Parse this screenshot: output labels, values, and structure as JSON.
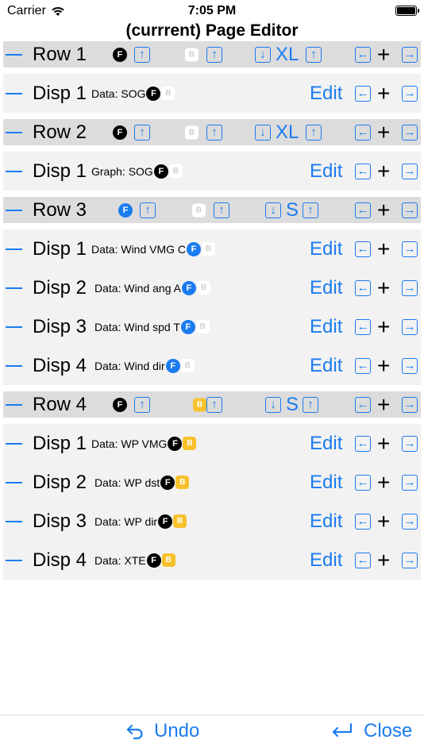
{
  "status": {
    "carrier": "Carrier",
    "time": "7:05 PM"
  },
  "title": "(currrent) Page Editor",
  "icons": {
    "f": "F",
    "b": "B",
    "up": "↑",
    "down": "↓",
    "left": "←",
    "right": "→",
    "plus": "+"
  },
  "colors": {
    "accent": "#1b7cf0",
    "black_badge": "#000000",
    "blue_badge": "#1b7cf0",
    "yellow_badge": "#f8c12c",
    "header_bg": "#dcdcdc",
    "row_bg": "#f2f2f2"
  },
  "rows": [
    {
      "label": "Row 1",
      "font_badge": "black",
      "bg_badge": "white",
      "size": "XL",
      "displays": [
        {
          "label": "Disp 1",
          "info": "Data: SOG",
          "font_badge": "black",
          "bg_badge": "white"
        }
      ]
    },
    {
      "label": "Row 2",
      "font_badge": "black",
      "bg_badge": "white",
      "size": "XL",
      "displays": [
        {
          "label": "Disp 1",
          "info": "Graph: SOG",
          "font_badge": "black",
          "bg_badge": "white"
        }
      ]
    },
    {
      "label": "Row 3",
      "font_badge": "blue",
      "bg_badge": "white",
      "size": "S",
      "displays": [
        {
          "label": "Disp 1",
          "info": "Data: Wind VMG C",
          "font_badge": "blue",
          "bg_badge": "white"
        },
        {
          "label": "Disp 2",
          "info": "Data: Wind ang A",
          "font_badge": "blue",
          "bg_badge": "white"
        },
        {
          "label": "Disp 3",
          "info": "Data: Wind spd T",
          "font_badge": "blue",
          "bg_badge": "white"
        },
        {
          "label": "Disp 4",
          "info": "Data: Wind dir",
          "font_badge": "blue",
          "bg_badge": "white"
        }
      ]
    },
    {
      "label": "Row 4",
      "font_badge": "black",
      "bg_badge": "yellow",
      "size": "S",
      "displays": [
        {
          "label": "Disp 1",
          "info": "Data: WP VMG",
          "font_badge": "black",
          "bg_badge": "yellow"
        },
        {
          "label": "Disp 2",
          "info": "Data: WP dst",
          "font_badge": "black",
          "bg_badge": "yellow"
        },
        {
          "label": "Disp 3",
          "info": "Data: WP dir",
          "font_badge": "black",
          "bg_badge": "yellow"
        },
        {
          "label": "Disp 4",
          "info": "Data: XTE",
          "font_badge": "black",
          "bg_badge": "yellow"
        }
      ]
    }
  ],
  "edit_label": "Edit",
  "footer": {
    "undo": "Undo",
    "close": "Close"
  }
}
